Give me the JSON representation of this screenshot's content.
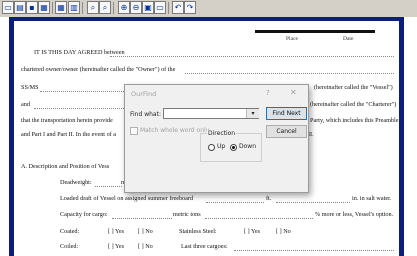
{
  "toolbar": {
    "buttons": [
      {
        "name": "new-doc-icon",
        "glyph": "▭"
      },
      {
        "name": "open-icon",
        "glyph": "▤"
      },
      {
        "name": "save-icon",
        "glyph": "▪"
      },
      {
        "name": "print-icon",
        "glyph": "▦"
      },
      {
        "name": "insert-table-icon",
        "glyph": "▦"
      },
      {
        "name": "columns-icon",
        "glyph": "▥"
      },
      {
        "name": "find-icon",
        "glyph": "⌕"
      },
      {
        "name": "replace-icon",
        "glyph": "⌕"
      },
      {
        "name": "zoom-in-icon",
        "glyph": "⊕"
      },
      {
        "name": "zoom-out-icon",
        "glyph": "⊖"
      },
      {
        "name": "fit-page-icon",
        "glyph": "▣"
      },
      {
        "name": "comment-icon",
        "glyph": "▭"
      },
      {
        "name": "undo-icon",
        "glyph": "↶"
      },
      {
        "name": "redo-icon",
        "glyph": "↷"
      }
    ]
  },
  "document": {
    "header_place": "Place",
    "header_date": "Date",
    "line1": "IT IS THIS DAY AGREED between",
    "line2": "chartered owner/owner (hereinafter called the \"Owner\") of the",
    "line3a": "SS/MS",
    "line3b": "(hereinafter called the \"Vessel\")",
    "line4a": "and",
    "line4b": "(hereinafter called the \"Charterer\")",
    "line5a": "that the transportation herein provide",
    "line5b": "Party, which includes this Preamble",
    "line6a": "and Part I and Part II. In the event of a",
    "line6b": "II.",
    "section_a": "A.   Description and Position of Vess",
    "deadweight": "Deadweight:",
    "deadweight_tail": "m",
    "loaded_draft": "Loaded draft of Vessel on assigned summer freeboard",
    "loaded_ft": "ft.",
    "loaded_tail": "in. in salt water.",
    "capacity": "Capacity for cargo:",
    "capacity_mid": "metric tons",
    "capacity_tail": "% more or less, Vessel's option.",
    "coated": "Coated:",
    "coated_yes": "[ ] Yes",
    "coated_no": "[ ] No",
    "stainless": "Stainless Steel:",
    "stainless_yes": "[ ] Yes",
    "stainless_no": "[ ] No",
    "coiled": "Coiled:",
    "coiled_yes": "[ ] Yes",
    "coiled_no": "[ ] No",
    "last_cargoes": "Last three cargoes:"
  },
  "dialog": {
    "title": "OurFind",
    "help": "?",
    "close": "✕",
    "find_what_label": "Find what:",
    "find_what_value": "",
    "find_next": "Find Next",
    "cancel": "Cancel",
    "match_whole_word": "Match whole word only",
    "match_whole_word_checked": false,
    "direction_label": "Direction",
    "up_label": "Up",
    "down_label": "Down",
    "direction_selected": "Down"
  }
}
